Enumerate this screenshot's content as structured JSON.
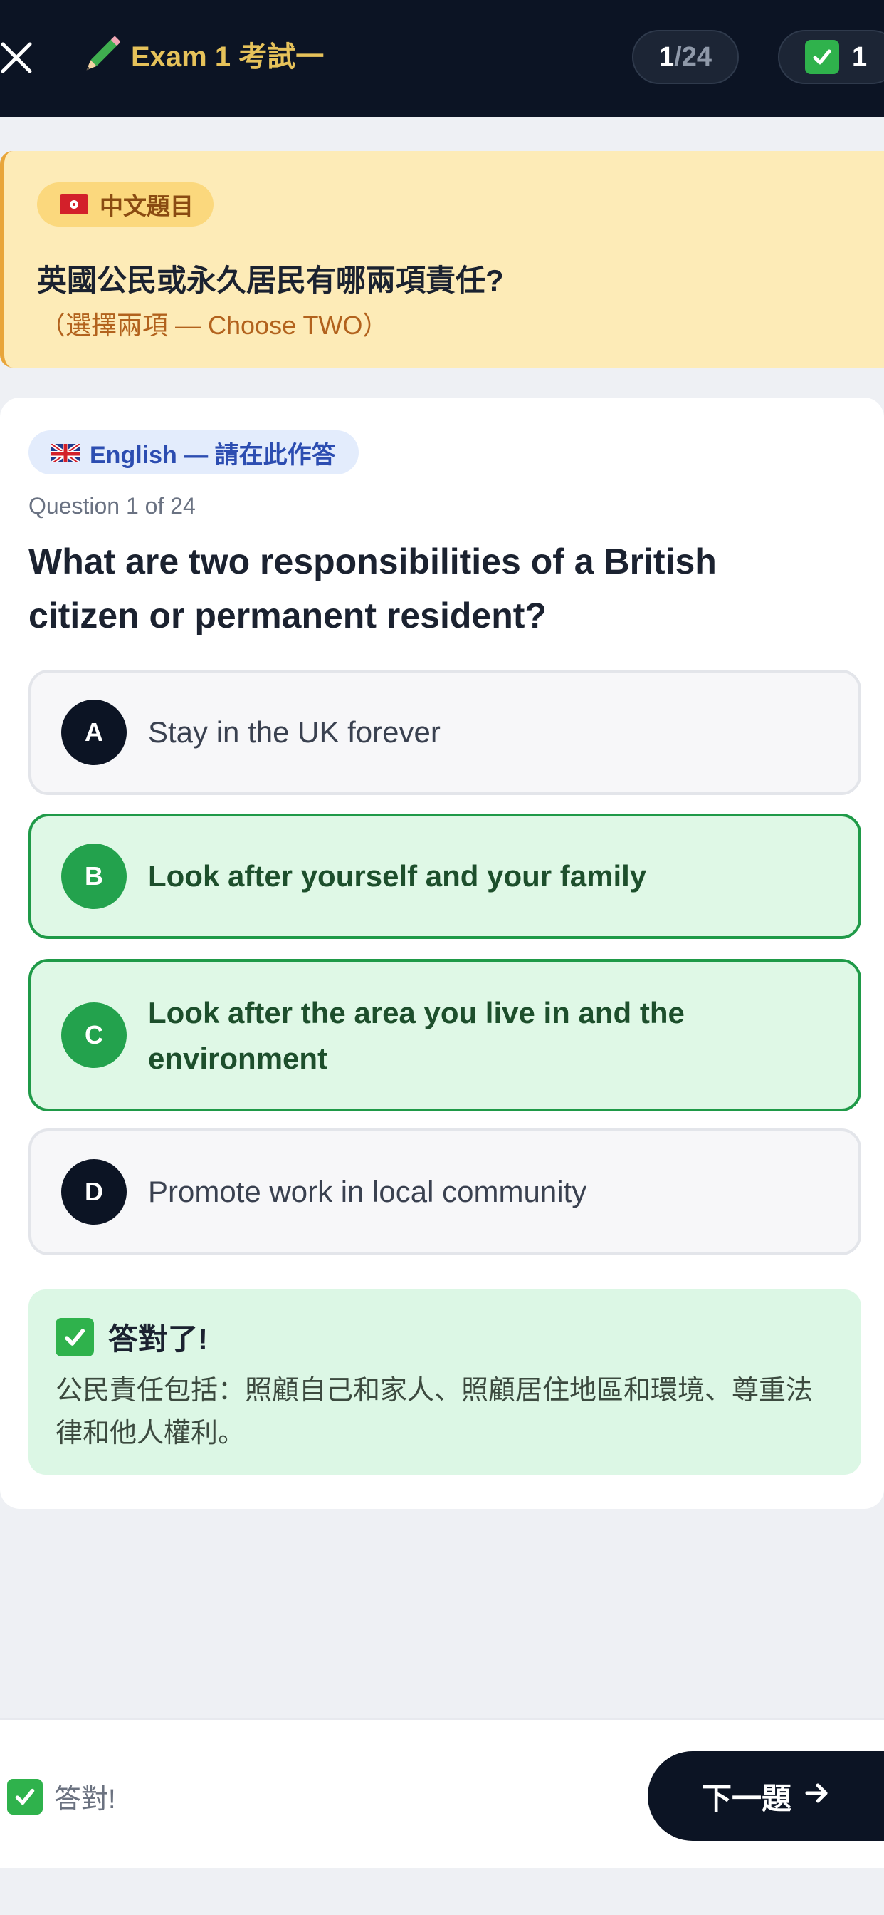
{
  "header": {
    "title": "Exam 1 考試一",
    "progress_current": "1",
    "progress_total": "/24",
    "score": "1",
    "icons": {
      "close": "close-icon",
      "exam": "pencil-icon",
      "score": "check-icon"
    }
  },
  "chinese_card": {
    "badge_label": "中文題目",
    "badge_icon": "hk-flag-icon",
    "question": "英國公民或永久居民有哪兩項責任?",
    "instruction": "（選擇兩項 — Choose TWO）"
  },
  "english_card": {
    "badge_label": "English — 請在此作答",
    "badge_icon": "uk-flag-icon",
    "counter": "Question 1 of 24",
    "question": "What are two responsibilities of a British citizen or permanent resident?",
    "options": [
      {
        "letter": "A",
        "text": "Stay in the UK forever",
        "selected": false
      },
      {
        "letter": "B",
        "text": "Look after yourself and your family",
        "selected": true
      },
      {
        "letter": "C",
        "text": "Look after the area you live in and the environment",
        "selected": true
      },
      {
        "letter": "D",
        "text": "Promote work in local community",
        "selected": false
      }
    ]
  },
  "feedback": {
    "title": "答對了!",
    "body": "公民責任包括：照顧自己和家人、照顧居住地區和環境、尊重法律和他人權利。"
  },
  "footer": {
    "status": "答對!",
    "next_label": "下一題",
    "next_icon": "arrow-right-icon"
  },
  "colors": {
    "header_bg": "#0c1424",
    "title_gold": "#e6c25a",
    "correct_green": "#23a24d",
    "zh_card_bg": "#fdebb7"
  }
}
